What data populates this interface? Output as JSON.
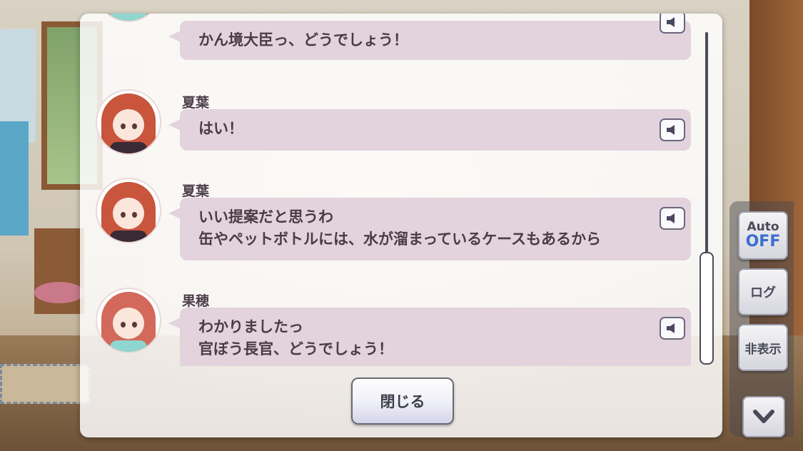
{
  "log": {
    "entries": [
      {
        "speaker": "",
        "character": "kaho",
        "lines": [
          "かん境大臣っ、どうでしょう！"
        ]
      },
      {
        "speaker": "夏葉",
        "character": "natsuha",
        "lines": [
          "はい！"
        ]
      },
      {
        "speaker": "夏葉",
        "character": "natsuha",
        "lines": [
          "いい提案だと思うわ",
          "缶やペットボトルには、水が溜まっているケースもあるから"
        ]
      },
      {
        "speaker": "果穂",
        "character": "kaho",
        "lines": [
          "わかりましたっ",
          "官ぼう長官、どうでしょう！"
        ]
      }
    ],
    "voice_icon": "speaker-icon",
    "close_label": "閉じる"
  },
  "controls": {
    "auto_label": "Auto",
    "auto_state": "OFF",
    "log_label": "ログ",
    "hide_label": "非表示",
    "down_icon": "chevron-down-icon"
  },
  "colors": {
    "bubble": "#e3d3dc",
    "text": "#4a3c46",
    "auto_off": "#3a6ed0"
  }
}
